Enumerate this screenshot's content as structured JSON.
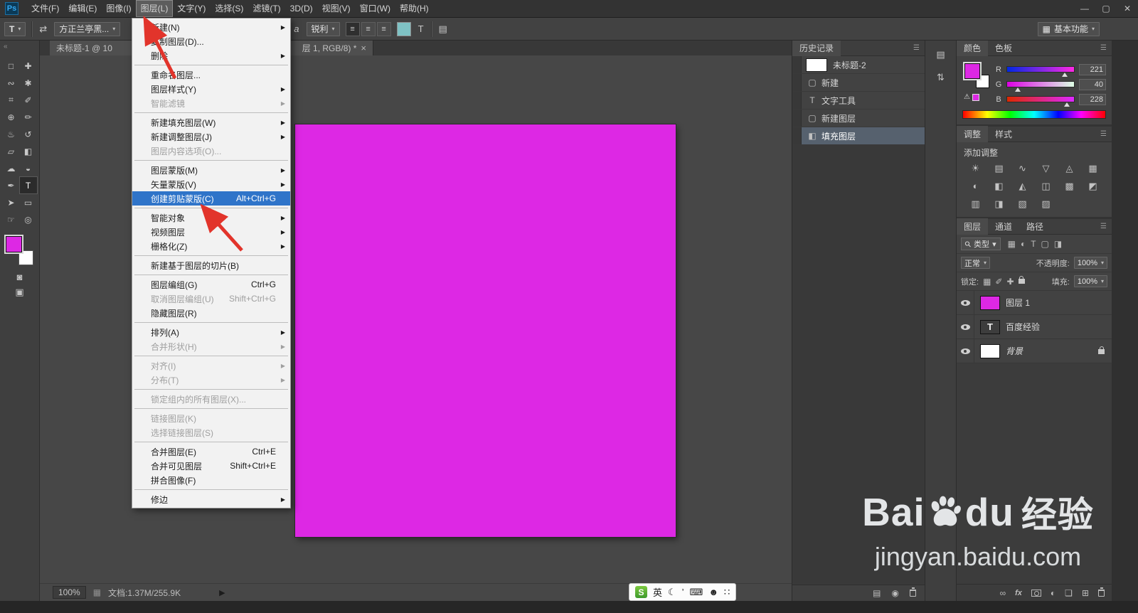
{
  "icons": {
    "combo_arrow": "▾",
    "panel_menu": "☰",
    "submenu_arrow": "▶",
    "collapse_chevrons": "«"
  },
  "titlebar": {
    "logo": "Ps",
    "menus": [
      {
        "label": "文件(F)"
      },
      {
        "label": "编辑(E)"
      },
      {
        "label": "图像(I)"
      },
      {
        "label": "图层(L)",
        "active": true
      },
      {
        "label": "文字(Y)"
      },
      {
        "label": "选择(S)"
      },
      {
        "label": "滤镜(T)"
      },
      {
        "label": "3D(D)"
      },
      {
        "label": "视图(V)"
      },
      {
        "label": "窗口(W)"
      },
      {
        "label": "帮助(H)"
      }
    ],
    "window": {
      "min": "—",
      "max": "▢",
      "close": "✕"
    }
  },
  "options_bar": {
    "tool_glyph": "T",
    "orient_icon": "⇄",
    "font_value": "方正兰亭黑...",
    "aa_icon": "a",
    "aa_value": "锐利",
    "align_icons": [
      "≡",
      "≡",
      "≡"
    ],
    "text_color": "#7fc2c4",
    "warp_icon": "T",
    "panels_icon": "▤",
    "workspace_icon": "▦",
    "workspace": "基本功能"
  },
  "doc_tab": {
    "title_left": "未标题-1 @ 10",
    "title_right": "层 1, RGB/8) *",
    "close": "×"
  },
  "layer_menu": {
    "items": [
      {
        "label": "新建(N)",
        "submenu": true
      },
      {
        "label": "复制图层(D)..."
      },
      {
        "label": "删除",
        "submenu": true
      },
      {
        "sep": true
      },
      {
        "label": "重命名图层..."
      },
      {
        "label": "图层样式(Y)",
        "submenu": true
      },
      {
        "label": "智能滤镜",
        "submenu": true,
        "disabled": true
      },
      {
        "sep": true
      },
      {
        "label": "新建填充图层(W)",
        "submenu": true
      },
      {
        "label": "新建调整图层(J)",
        "submenu": true
      },
      {
        "label": "图层内容选项(O)...",
        "disabled": true
      },
      {
        "sep": true
      },
      {
        "label": "图层蒙版(M)",
        "submenu": true
      },
      {
        "label": "矢量蒙版(V)",
        "submenu": true
      },
      {
        "label": "创建剪贴蒙版(C)",
        "shortcut": "Alt+Ctrl+G",
        "highlighted": true
      },
      {
        "sep": true
      },
      {
        "label": "智能对象",
        "submenu": true
      },
      {
        "label": "视频图层",
        "submenu": true
      },
      {
        "label": "栅格化(Z)",
        "submenu": true
      },
      {
        "sep": true
      },
      {
        "label": "新建基于图层的切片(B)"
      },
      {
        "sep": true
      },
      {
        "label": "图层编组(G)",
        "shortcut": "Ctrl+G"
      },
      {
        "label": "取消图层编组(U)",
        "shortcut": "Shift+Ctrl+G",
        "disabled": true
      },
      {
        "label": "隐藏图层(R)"
      },
      {
        "sep": true
      },
      {
        "label": "排列(A)",
        "submenu": true
      },
      {
        "label": "合并形状(H)",
        "submenu": true,
        "disabled": true
      },
      {
        "sep": true
      },
      {
        "label": "对齐(I)",
        "submenu": true,
        "disabled": true
      },
      {
        "label": "分布(T)",
        "submenu": true,
        "disabled": true
      },
      {
        "sep": true
      },
      {
        "label": "锁定组内的所有图层(X)...",
        "disabled": true
      },
      {
        "sep": true
      },
      {
        "label": "链接图层(K)",
        "disabled": true
      },
      {
        "label": "选择链接图层(S)",
        "disabled": true
      },
      {
        "sep": true
      },
      {
        "label": "合并图层(E)",
        "shortcut": "Ctrl+E"
      },
      {
        "label": "合并可见图层",
        "shortcut": "Shift+Ctrl+E"
      },
      {
        "label": "拼合图像(F)"
      },
      {
        "sep": true
      },
      {
        "label": "修边",
        "submenu": true
      }
    ]
  },
  "toolbar": {
    "tools": [
      {
        "name": "rectangular-marquee-tool",
        "glyph": "□"
      },
      {
        "name": "move-tool",
        "glyph": "✚"
      },
      {
        "name": "lasso-tool",
        "glyph": "∾"
      },
      {
        "name": "quick-selection-tool",
        "glyph": "✱"
      },
      {
        "name": "crop-tool",
        "glyph": "⌗"
      },
      {
        "name": "eyedropper-tool",
        "glyph": "✐"
      },
      {
        "name": "healing-brush-tool",
        "glyph": "⊕"
      },
      {
        "name": "brush-tool",
        "glyph": "✏"
      },
      {
        "name": "clone-stamp-tool",
        "glyph": "♨"
      },
      {
        "name": "history-brush-tool",
        "glyph": "↺"
      },
      {
        "name": "eraser-tool",
        "glyph": "▱"
      },
      {
        "name": "gradient-tool",
        "glyph": "◧"
      },
      {
        "name": "blur-tool",
        "glyph": "☁"
      },
      {
        "name": "dodge-tool",
        "glyph": "◒"
      },
      {
        "name": "pen-tool",
        "glyph": "✒"
      },
      {
        "name": "type-tool",
        "glyph": "T",
        "active": true
      },
      {
        "name": "path-selection-tool",
        "glyph": "➤"
      },
      {
        "name": "shape-tool",
        "glyph": "▭"
      },
      {
        "name": "hand-tool",
        "glyph": "☞"
      },
      {
        "name": "zoom-tool",
        "glyph": "◎"
      }
    ],
    "quick_mask_glyph": "◙",
    "screen_mode_glyph": "▣"
  },
  "canvas": {
    "fill": "#dd28e4"
  },
  "statusbar": {
    "zoom": "100%",
    "icon": "▦",
    "doc_info": "文档:1.37M/255.9K",
    "flyout": "▶"
  },
  "history": {
    "title": "历史记录",
    "items": [
      {
        "label": "未标题-2",
        "thumb": true
      },
      {
        "label": "新建",
        "glyph": "▢"
      },
      {
        "label": "文字工具",
        "glyph": "T"
      },
      {
        "label": "新建图层",
        "glyph": "▢"
      },
      {
        "label": "填充图层",
        "glyph": "◧",
        "selected": true
      }
    ],
    "footer_icons": [
      {
        "name": "new-document-from-state-button",
        "glyph": "▤"
      },
      {
        "name": "new-snapshot-button",
        "glyph": "◉"
      },
      {
        "name": "delete-state-button",
        "cls": "icon-trash"
      }
    ]
  },
  "color_panel": {
    "tabs": [
      "颜色",
      "色板"
    ],
    "warning": "⚠",
    "channels": [
      {
        "label": "R",
        "value": 221
      },
      {
        "label": "G",
        "value": 40
      },
      {
        "label": "B",
        "value": 228
      }
    ]
  },
  "adjustments": {
    "tabs": [
      "调整",
      "样式"
    ],
    "title": "添加调整",
    "icons": [
      "☀",
      "▤",
      "∿",
      "▽",
      "◬",
      "▦",
      "◐",
      "◧",
      "◭",
      "◫",
      "▩",
      "◩",
      "▥",
      "◨",
      "▧",
      "▨"
    ]
  },
  "layers_panel": {
    "tabs": [
      "图层",
      "通道",
      "路径"
    ],
    "filter_label": "类型",
    "filter_icons": [
      {
        "name": "filter-pixel-layers-icon",
        "glyph": "▦"
      },
      {
        "name": "filter-adjustment-layers-icon",
        "glyph": "◐"
      },
      {
        "name": "filter-type-layers-icon",
        "glyph": "T"
      },
      {
        "name": "filter-shape-layers-icon",
        "glyph": "▢"
      },
      {
        "name": "filter-smart-objects-icon",
        "glyph": "◨"
      }
    ],
    "blend_mode": "正常",
    "opacity_label": "不透明度:",
    "opacity": "100%",
    "lock_label": "锁定:",
    "lock_icons": [
      {
        "name": "lock-transparent-pixels-icon",
        "glyph": "▦"
      },
      {
        "name": "lock-image-pixels-icon",
        "glyph": "✐"
      },
      {
        "name": "lock-position-icon",
        "glyph": "✚"
      },
      {
        "name": "lock-all-icon",
        "cls": "css-lock"
      }
    ],
    "fill_label": "填充:",
    "fill": "100%",
    "layers": [
      {
        "name": "图层 1",
        "thumb": "color",
        "selected": true
      },
      {
        "name": "百度经验",
        "thumb": "T"
      },
      {
        "name": "背景",
        "thumb": "white",
        "locked": true,
        "italic": true
      }
    ],
    "footer_icons": [
      {
        "name": "link-layers-button",
        "glyph": "∞"
      },
      {
        "name": "layer-style-button",
        "glyph": "fx",
        "cls2": "fx"
      },
      {
        "name": "add-layer-mask-button",
        "cls": "icon-mask"
      },
      {
        "name": "new-adjustment-layer-button",
        "glyph": "◐"
      },
      {
        "name": "new-group-button",
        "glyph": "❏"
      },
      {
        "name": "new-layer-button",
        "glyph": "⊞"
      },
      {
        "name": "delete-layer-button",
        "cls": "icon-trash"
      }
    ]
  },
  "dock_strip": {
    "icons": [
      {
        "name": "dock-panel-icon-1",
        "glyph": "▤"
      },
      {
        "name": "dock-panel-icon-2",
        "glyph": "⇅"
      }
    ]
  },
  "watermark": {
    "bai": "Bai",
    "du": "du",
    "jingyan": "经验",
    "url": "jingyan.baidu.com"
  },
  "ime": {
    "logo": "S",
    "icons": [
      {
        "name": "ime-mode-english",
        "glyph": "英"
      },
      {
        "name": "ime-moon-icon",
        "glyph": "☾"
      },
      {
        "name": "ime-punct-icon",
        "glyph": "’"
      },
      {
        "name": "ime-keyboard-icon",
        "glyph": "⌨"
      },
      {
        "name": "ime-user-icon",
        "glyph": "☻"
      },
      {
        "name": "ime-menu-icon",
        "glyph": "∷"
      }
    ]
  },
  "arrows_color": "#e2342b"
}
